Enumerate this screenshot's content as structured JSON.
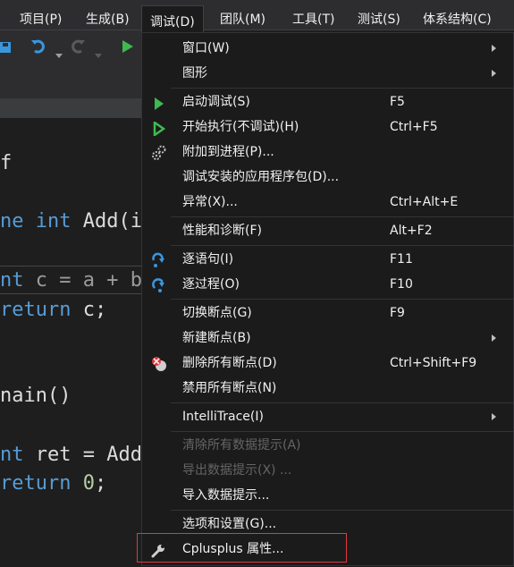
{
  "menubar": {
    "items": [
      {
        "label": "项目(P)"
      },
      {
        "label": "生成(B)"
      },
      {
        "label": "调试(D)"
      },
      {
        "label": "团队(M)"
      },
      {
        "label": "工具(T)"
      },
      {
        "label": "测试(S)"
      },
      {
        "label": "体系结构(C)"
      }
    ]
  },
  "editor": {
    "lines": {
      "l1": "f",
      "l2_kw": "ne int",
      "l2_fn": " Add(in",
      "l3_kw": "nt",
      "l3_rest": " c = a + b",
      "l4_kw": "return",
      "l4_rest": " c;",
      "l5": "nain()",
      "l6_kw": "nt",
      "l6_rest": " ret = Add",
      "l7_kw": "return",
      "l7_num": " 0",
      "l7_rest": ";"
    }
  },
  "debug_menu": {
    "items": [
      {
        "label": "窗口(W)",
        "shortcut": "",
        "submenu": true
      },
      {
        "label": "图形",
        "shortcut": "",
        "submenu": true
      },
      {
        "label": "启动调试(S)",
        "shortcut": "F5",
        "icon": "play-green-icon"
      },
      {
        "label": "开始执行(不调试)(H)",
        "shortcut": "Ctrl+F5",
        "icon": "play-outline-icon"
      },
      {
        "label": "附加到进程(P)...",
        "shortcut": "",
        "icon": "gears-icon"
      },
      {
        "label": "调试安装的应用程序包(D)...",
        "shortcut": ""
      },
      {
        "label": "异常(X)...",
        "shortcut": "Ctrl+Alt+E"
      },
      {
        "label": "性能和诊断(F)",
        "shortcut": "Alt+F2"
      },
      {
        "label": "逐语句(I)",
        "shortcut": "F11",
        "icon": "step-into-icon"
      },
      {
        "label": "逐过程(O)",
        "shortcut": "F10",
        "icon": "step-over-icon"
      },
      {
        "label": "切换断点(G)",
        "shortcut": "F9"
      },
      {
        "label": "新建断点(B)",
        "shortcut": "",
        "submenu": true
      },
      {
        "label": "删除所有断点(D)",
        "shortcut": "Ctrl+Shift+F9",
        "icon": "delete-breakpoints-icon"
      },
      {
        "label": "禁用所有断点(N)",
        "shortcut": ""
      },
      {
        "label": "IntelliTrace(I)",
        "shortcut": "",
        "submenu": true
      },
      {
        "label": "清除所有数据提示(A)",
        "shortcut": "",
        "disabled": true
      },
      {
        "label": "导出数据提示(X) ...",
        "shortcut": "",
        "disabled": true
      },
      {
        "label": "导入数据提示...",
        "shortcut": ""
      },
      {
        "label": "选项和设置(G)...",
        "shortcut": ""
      },
      {
        "label": "Cplusplus 属性...",
        "shortcut": "",
        "icon": "wrench-icon",
        "highlighted": true
      }
    ]
  },
  "colors": {
    "menu_bg": "#1b1b1c",
    "menubar_bg": "#2d2d30",
    "text": "#f1f1f1",
    "disabled_text": "#656565",
    "play_green": "#3fb950",
    "step_blue": "#3a96dd",
    "highlight_red": "#e0393e"
  }
}
